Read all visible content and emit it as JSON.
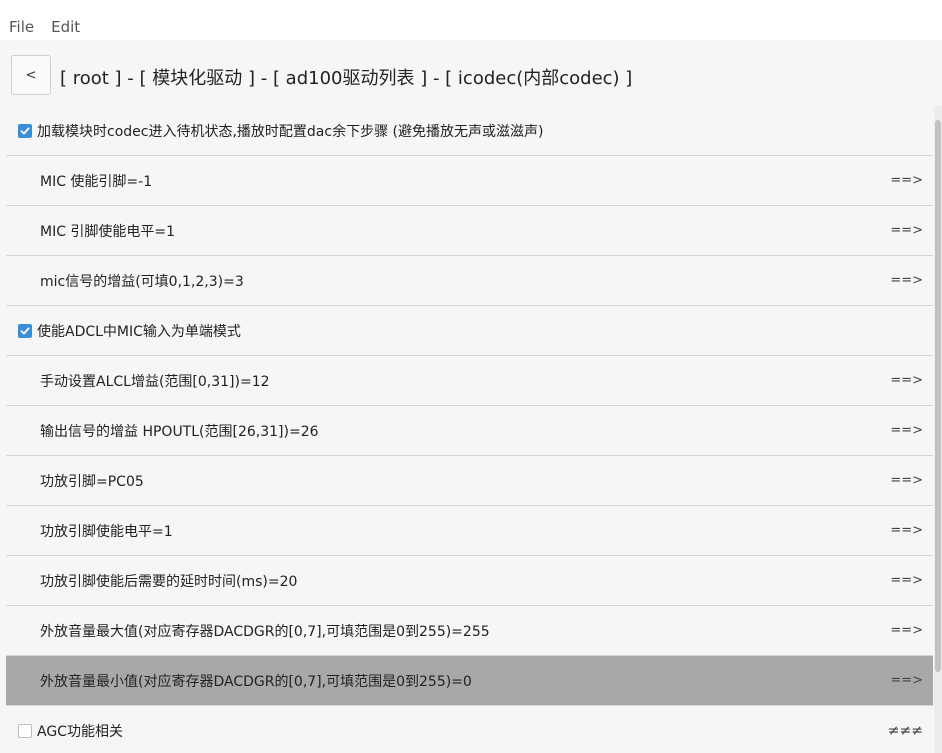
{
  "menubar": {
    "file": "File",
    "edit": "Edit"
  },
  "nav": {
    "back_label": "<",
    "breadcrumb": "[ root ] - [ 模块化驱动 ] - [ ad100驱动列表 ] - [ icodec(内部codec) ]"
  },
  "arrow_text": "==>",
  "agc_extra": "≠≠≠",
  "rows": [
    {
      "type": "toggle",
      "checked": true,
      "label": "加载模块时codec进入待机状态,播放时配置dac余下步骤 (避免播放无声或滋滋声)"
    },
    {
      "type": "param",
      "label": "MIC 使能引脚=-1"
    },
    {
      "type": "param",
      "label": "MIC 引脚使能电平=1"
    },
    {
      "type": "param",
      "label": "mic信号的增益(可填0,1,2,3)=3"
    },
    {
      "type": "toggle",
      "checked": true,
      "label": "使能ADCL中MIC输入为单端模式"
    },
    {
      "type": "param",
      "label": "手动设置ALCL增益(范围[0,31])=12"
    },
    {
      "type": "param",
      "label": "输出信号的增益 HPOUTL(范围[26,31])=26"
    },
    {
      "type": "param",
      "label": "功放引脚=PC05"
    },
    {
      "type": "param",
      "label": "功放引脚使能电平=1"
    },
    {
      "type": "param",
      "label": "功放引脚使能后需要的延时时间(ms)=20"
    },
    {
      "type": "param",
      "label": "外放音量最大值(对应寄存器DACDGR的[0,7],可填范围是0到255)=255"
    },
    {
      "type": "param",
      "label": "外放音量最小值(对应寄存器DACDGR的[0,7],可填范围是0到255)=0",
      "selected": true
    },
    {
      "type": "toggle",
      "checked": false,
      "label": "AGC功能相关"
    }
  ]
}
